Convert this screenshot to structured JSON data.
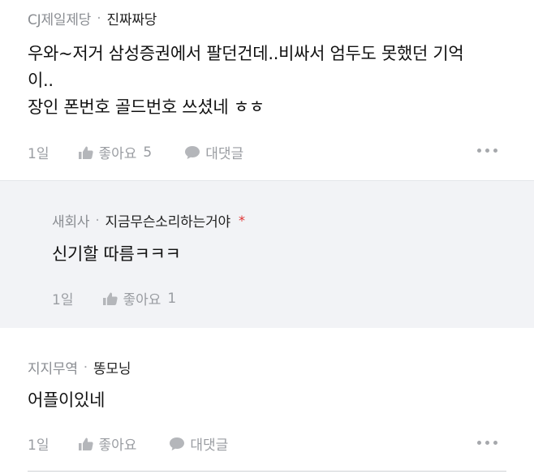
{
  "comments": [
    {
      "category": "CJ제일제당",
      "separator": "·",
      "nickname": "진짜짜당",
      "lines": [
        "우와~저거 삼성증권에서 팔던건데..비싸서 엄두도 못했던 기억",
        "이..",
        "장인 폰번호 골드번호 쓰셨네 ㅎㅎ"
      ],
      "time": "1일",
      "like_label": "좋아요",
      "like_count": "5",
      "reply_label": "대댓글"
    },
    {
      "category": "새회사",
      "separator": "·",
      "nickname": "지금무슨소리하는거야",
      "star": "*",
      "lines": [
        "신기할 따름ㅋㅋㅋ"
      ],
      "time": "1일",
      "like_label": "좋아요",
      "like_count": "1"
    },
    {
      "category": "지지무역",
      "separator": "·",
      "nickname": "똥모닝",
      "lines": [
        "어플이있네"
      ],
      "time": "1일",
      "like_label": "좋아요",
      "reply_label": "대댓글"
    }
  ],
  "icons": {
    "like": "thumbs-up-icon",
    "reply": "speech-bubble-icon",
    "more": "more-horizontal-icon"
  },
  "colors": {
    "reply_background": "#f2f3f6",
    "meta_gray": "#8a8d92",
    "star_red": "#e03131"
  }
}
